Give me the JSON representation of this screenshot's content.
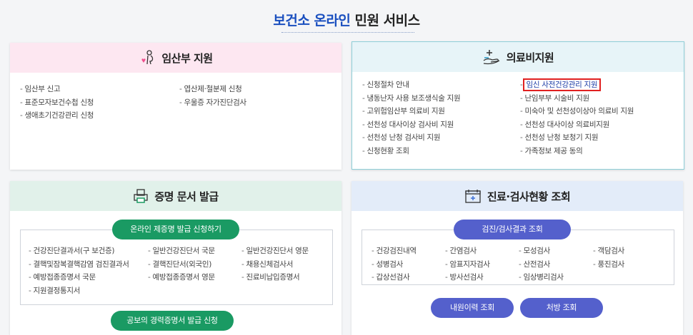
{
  "page": {
    "title_highlight": "보건소 온라인",
    "title_rest": " 민원 서비스"
  },
  "maternity": {
    "title": "임산부 지원",
    "col1": [
      "임산부 신고",
      "표준모자보건수첩 신청",
      "생애초기건강관리 신청"
    ],
    "col2": [
      "엽산제·철분제 신청",
      "우울증 자가진단검사"
    ]
  },
  "medical": {
    "title": "의료비지원",
    "col1": [
      "신청절차 안내",
      "냉동난자 사용 보조생식술 지원",
      "고위험임산부 의료비 지원",
      "선천성 대사이상 검사비 지원",
      "선천성 난청 검사비 지원",
      "신청현황 조회"
    ],
    "col2": [
      "임신 사전건강관리 지원",
      "난임부부 시술비 지원",
      "미숙아 및 선천성이상아 의료비 지원",
      "선천성 대사이상 의료비지원",
      "선천성 난청 보청기 지원",
      "가족정보 제공 동의"
    ]
  },
  "certificate": {
    "title": "증명 문서 발급",
    "top_button": "온라인 제증명 발급 신청하기",
    "col1": [
      "건강진단결과서(구 보건증)",
      "결핵및잠복결핵감염 검진결과서",
      "예방접종증명서 국문",
      "지원결정통지서"
    ],
    "col2": [
      "일반건강진단서 국문",
      "결핵진단서(외국인)",
      "예방접종증명서 영문"
    ],
    "col3": [
      "일반건강진단서 영문",
      "채용신체검사서",
      "진료비납입증명서"
    ],
    "bottom_button": "공보의 경력증명서 발급 신청"
  },
  "exam": {
    "title": "진료·검사현황 조회",
    "top_button": "검진/검사결과 조회",
    "col1": [
      "건강검진내역",
      "성병검사",
      "갑상선검사"
    ],
    "col2": [
      "간염검사",
      "암표지자검사",
      "방사선검사"
    ],
    "col3": [
      "모성검사",
      "산전검사",
      "임상병리검사"
    ],
    "col4": [
      "객담검사",
      "풍진검사"
    ],
    "button_history": "내원이력 조회",
    "button_prescription": "처방 조회"
  },
  "colors": {
    "maternity_head": "#fde7f1",
    "medical_head": "#e7f4f8",
    "certificate_head": "#e1f1ea",
    "exam_head": "#e3ecf9",
    "green_button": "#1a9a63",
    "blue_button": "#5460cc",
    "title_blue": "#1a4fbf"
  },
  "icons": {
    "maternity": "pregnant-woman-icon",
    "medical": "hand-plus-icon",
    "certificate": "printer-icon",
    "exam": "medical-chart-icon"
  }
}
